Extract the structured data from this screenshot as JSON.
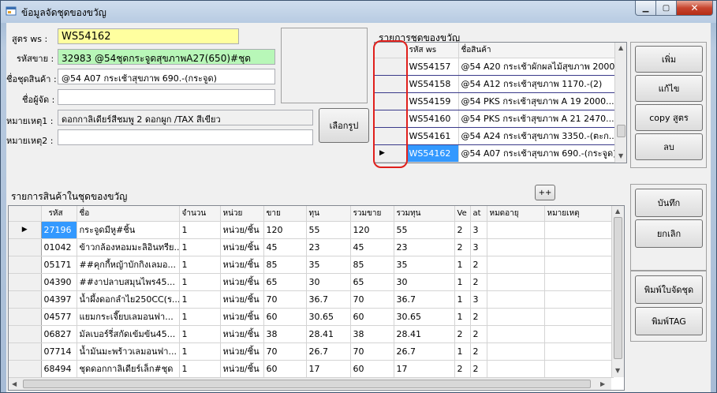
{
  "window": {
    "title": "ข้อมูลจัดชุดของขวัญ",
    "min_label": "▁",
    "max_label": "▢",
    "close_label": "✕"
  },
  "form": {
    "ws_label": "สูตร ws :",
    "ws_value": "WS54162",
    "sale_code_label": "รหัสขาย :",
    "sale_code_value": "32983      @54ชุดกระจูดสุขภาพA27(650)#ชุด",
    "product_name_label": "ชื่อชุดสินค้า :",
    "product_name_value": "@54 A07 กระเช้าสุขภาพ 690.-(กระจูด)",
    "organizer_label": "ชื่อผู้จัด :",
    "organizer_value": "",
    "note1_label": "หมายเหตุ1 :",
    "note1_value": "ดอกกาลิเดียร์สีชมพู 2 ดอกผูก /TAX สีเขียว",
    "note2_label": "หมายเหตุ2 :",
    "note2_value": "",
    "choose_image_label": "เลือกรูป"
  },
  "gift_sets": {
    "title": "รายการชุดของขวัญ",
    "columns": [
      "รหัส ws",
      "ชื่อสินค้า"
    ],
    "rows": [
      {
        "code": "WS54157",
        "name": "@54 A20 กระเช้าผักผลไม้สุขภาพ 2000..."
      },
      {
        "code": "WS54158",
        "name": "@54 A12 กระเช้าสุขภาพ 1170.-(2)"
      },
      {
        "code": "WS54159",
        "name": "@54 PKS กระเช้าสุขภาพ A 19 2000...."
      },
      {
        "code": "WS54160",
        "name": "@54 PKS กระเช้าสุขภาพ A 21 2470...."
      },
      {
        "code": "WS54161",
        "name": "@54 A24 กระเช้าสุขภาพ 3350.-(ตะก..."
      },
      {
        "code": "WS54162",
        "name": "@54 A07 กระเช้าสุขภาพ 690.-(กระจูด)"
      }
    ],
    "selected_marker": "▶"
  },
  "items": {
    "title": "รายการสินค้าในชุดของขวัญ",
    "plusplus_label": "++",
    "columns": [
      "รหัส",
      "ชื่อ",
      "จำนวน",
      "หน่วย",
      "ขาย",
      "ทุน",
      "รวมขาย",
      "รวมทุน",
      "Ve",
      "at",
      "หมดอายุ",
      "หมายเหตุ"
    ],
    "rows": [
      {
        "code": "27196",
        "name": "กระจูดมีหู#ชิ้น",
        "qty": "1",
        "unit": "หน่วย/ชิ้น",
        "sale": "120",
        "cost": "55",
        "total_sale": "120",
        "total_cost": "55",
        "v": "2",
        "at": "3",
        "exp": "",
        "note": ""
      },
      {
        "code": "01042",
        "name": "ข้าวกล้องหอมมะลิอินทรีย...",
        "qty": "1",
        "unit": "หน่วย/ชิ้น",
        "sale": "45",
        "cost": "23",
        "total_sale": "45",
        "total_cost": "23",
        "v": "2",
        "at": "3",
        "exp": "",
        "note": ""
      },
      {
        "code": "05171",
        "name": "##คุกกี้หญ้าบักกิงเลมอ...",
        "qty": "1",
        "unit": "หน่วย/ชิ้น",
        "sale": "85",
        "cost": "35",
        "total_sale": "85",
        "total_cost": "35",
        "v": "1",
        "at": "2",
        "exp": "",
        "note": ""
      },
      {
        "code": "04390",
        "name": "##งาปลาบสมุนไพร45...",
        "qty": "1",
        "unit": "หน่วย/ชิ้น",
        "sale": "65",
        "cost": "30",
        "total_sale": "65",
        "total_cost": "30",
        "v": "1",
        "at": "2",
        "exp": "",
        "note": ""
      },
      {
        "code": "04397",
        "name": "น้ำผึ้งดอกลำไย250CC(ร...",
        "qty": "1",
        "unit": "หน่วย/ชิ้น",
        "sale": "70",
        "cost": "36.7",
        "total_sale": "70",
        "total_cost": "36.7",
        "v": "1",
        "at": "3",
        "exp": "",
        "note": ""
      },
      {
        "code": "04577",
        "name": "แยมกระเจี๊ยบเลมอนฟา...",
        "qty": "1",
        "unit": "หน่วย/ชิ้น",
        "sale": "60",
        "cost": "30.65",
        "total_sale": "60",
        "total_cost": "30.65",
        "v": "1",
        "at": "2",
        "exp": "",
        "note": ""
      },
      {
        "code": "06827",
        "name": "มัลเบอร์รี่สกัดเข้มข้น45...",
        "qty": "1",
        "unit": "หน่วย/ชิ้น",
        "sale": "38",
        "cost": "28.41",
        "total_sale": "38",
        "total_cost": "28.41",
        "v": "2",
        "at": "2",
        "exp": "",
        "note": ""
      },
      {
        "code": "07714",
        "name": "น้ำมันมะพร้าวเลมอนฟา...",
        "qty": "1",
        "unit": "หน่วย/ชิ้น",
        "sale": "70",
        "cost": "26.7",
        "total_sale": "70",
        "total_cost": "26.7",
        "v": "1",
        "at": "2",
        "exp": "",
        "note": ""
      },
      {
        "code": "68494",
        "name": "ชุดดอกกาลิเดียร์เล็ก#ชุด",
        "qty": "1",
        "unit": "หน่วย/ชิ้น",
        "sale": "60",
        "cost": "17",
        "total_sale": "60",
        "total_cost": "17",
        "v": "2",
        "at": "2",
        "exp": "",
        "note": ""
      }
    ],
    "current_row_marker": "▶"
  },
  "actions": {
    "add": "เพิ่ม",
    "edit": "แก้ไข",
    "copy": "copy สูตร",
    "delete": "ลบ",
    "save": "บันทึก",
    "cancel": "ยกเลิก",
    "print_sheet": "พิมพ์ใบจัดชุด",
    "print_tag": "พิมพ์TAG"
  },
  "colors": {
    "ws_field": "#ffff9f",
    "code_field": "#b8f7b8",
    "selection": "#3399ff",
    "annotation_ring": "#e0201c"
  }
}
